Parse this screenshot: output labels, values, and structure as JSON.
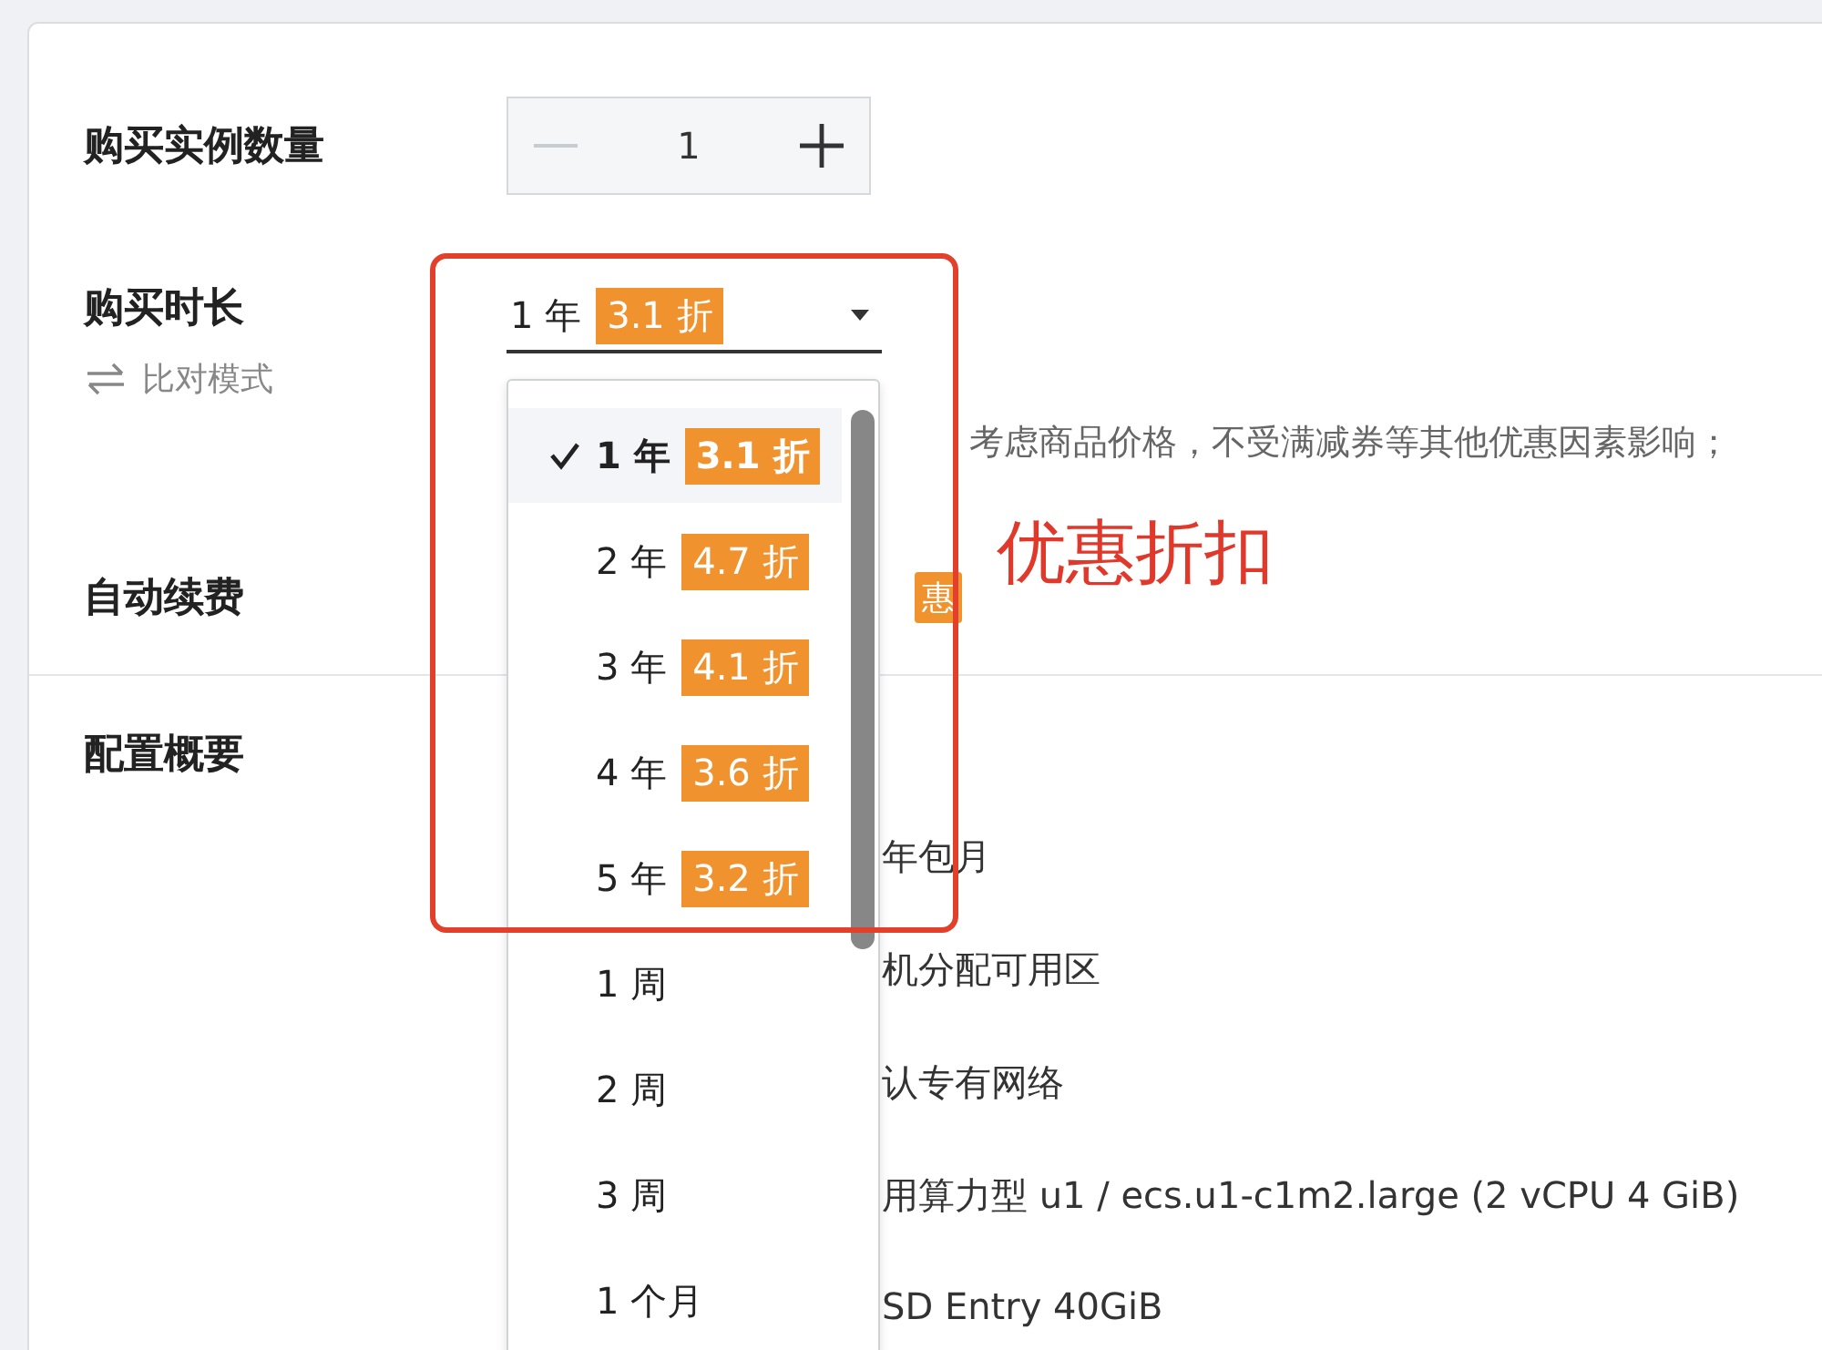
{
  "form": {
    "quantity": {
      "label": "购买实例数量",
      "value": "1",
      "decrement_disabled": true
    },
    "duration": {
      "label": "购买时长",
      "compare_mode": "比对模式",
      "selected_period": "1 年",
      "selected_discount": "3.1 折",
      "note": "考虑商品价格，不受满减券等其他优惠因素影响；",
      "options": [
        {
          "period": "1 年",
          "discount": "3.1 折",
          "selected": true
        },
        {
          "period": "2 年",
          "discount": "4.7 折",
          "selected": false
        },
        {
          "period": "3 年",
          "discount": "4.1 折",
          "selected": false
        },
        {
          "period": "4 年",
          "discount": "3.6 折",
          "selected": false
        },
        {
          "period": "5 年",
          "discount": "3.2 折",
          "selected": false
        },
        {
          "period": "1 周",
          "selected": false
        },
        {
          "period": "2 周",
          "selected": false
        },
        {
          "period": "3 周",
          "selected": false
        },
        {
          "period": "1 个月",
          "selected": false
        }
      ]
    },
    "auto_renew": {
      "label": "自动续费",
      "badge": "惠"
    },
    "summary": {
      "label": "配置概要",
      "rows": [
        "年包月",
        "机分配可用区",
        "认专有网络",
        "用算力型 u1 / ecs.u1-c1m2.large (2 vCPU 4 GiB)",
        "SD Entry 40GiB"
      ]
    }
  },
  "annotation": {
    "label": "优惠折扣"
  }
}
